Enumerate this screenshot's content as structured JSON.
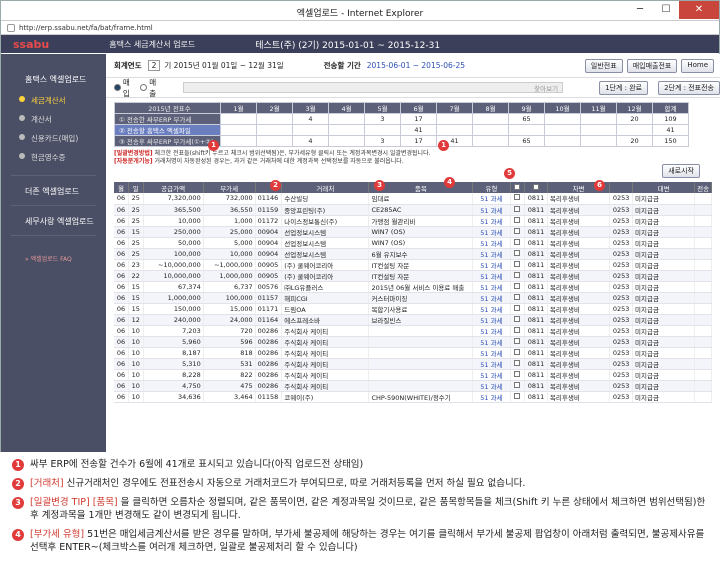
{
  "window": {
    "title": "엑셀업로드 - Internet Explorer",
    "url": "http://erp.ssabu.net/fa/bat/frame.html",
    "min": "─",
    "max": "☐",
    "close": "✕"
  },
  "topnav": {
    "logo": "ssabu",
    "title": "홈택스 세금계산서 업로드",
    "company": "테스트(주) (2기) 2015-01-01 ~ 2015-12-31"
  },
  "sidebar": {
    "header": "홈택스 엑셀업로드",
    "items": [
      {
        "label": "세금계산서"
      },
      {
        "label": "계산서"
      },
      {
        "label": "신용카드(매입)"
      },
      {
        "label": "현금영수증"
      }
    ],
    "section2": "더존 엑셀업로드",
    "section3": "세무사랑 엑셀업로드",
    "faq": "» 엑셀업로드 FAQ"
  },
  "toolbar": {
    "year_label": "회계연도",
    "year_sel": "2",
    "year_text": "기 2015년 01월 01일 ~ 12월 31일",
    "period_label": "전송할 기간",
    "period_value": "2015-06-01 ~ 2015-06-25",
    "btn1": "일반전표",
    "btn2": "매입매출전표",
    "btn3": "Home"
  },
  "filter": {
    "r1": "매입",
    "r2": "매출",
    "search": "찾아보기",
    "btn_step1": "1단계 : 완료",
    "btn_step2": "2단계 : 전표전송"
  },
  "summary": {
    "header_label": "2015년 전표수",
    "months": [
      "1월",
      "2월",
      "3월",
      "4월",
      "5월",
      "6월",
      "7월",
      "8월",
      "9월",
      "10월",
      "11월",
      "12월",
      "합계"
    ],
    "rows": [
      {
        "label": "① 전송한 싸부ERP 부가세",
        "vals": [
          "",
          "",
          "4",
          "",
          "3",
          "17",
          "",
          "",
          "65",
          "",
          "",
          "20",
          "109"
        ]
      },
      {
        "label": "② 전송할 홈택스 엑셀파일",
        "vals": [
          "",
          "",
          "",
          "",
          "",
          "41",
          "",
          "",
          "",
          "",
          "",
          "",
          "41"
        ]
      },
      {
        "label": "③ 전송후 싸부ERP 부가세(①+②)",
        "vals": [
          "",
          "",
          "4",
          "",
          "3",
          "17",
          "41",
          "",
          "65",
          "",
          "",
          "20",
          "150"
        ]
      }
    ]
  },
  "notice": {
    "l1a": "[일괄변경방법]",
    "l1b": "체크한 전표들(shift키 누르고 체크시 범위선택됨)은, 부가세유형 클릭시 또는 계정과목변경시 일괄변경됩니다.",
    "l2a": "[자동분개기능]",
    "l2b": "거래처명이 자동완성된 경우는, 과거 같은 거래처에 대한 계정과목 선택정보를 자동으로 불러옵니다.",
    "reset": "새로시작"
  },
  "grid": {
    "headers": [
      "월",
      "일",
      "공급가액",
      "부가세",
      "",
      "거래처",
      "품목",
      "유형",
      "",
      "",
      "차변",
      "",
      "대변",
      "",
      "전송"
    ],
    "rows": [
      [
        "06",
        "25",
        "7,320,000",
        "732,000",
        "01146",
        "수산빌딩",
        "임대료",
        "51 과세",
        "0811",
        "복리후생비",
        "0253",
        "미지급금"
      ],
      [
        "06",
        "25",
        "365,500",
        "36,550",
        "01159",
        "중앙프린팅(주)",
        "CE285AC",
        "51 과세",
        "0811",
        "복리후생비",
        "0253",
        "미지급금"
      ],
      [
        "06",
        "25",
        "10,000",
        "1,000",
        "01172",
        "나이스정보통신(주)",
        "가맹점 월관리비",
        "51 과세",
        "0811",
        "복리후생비",
        "0253",
        "미지급금"
      ],
      [
        "06",
        "15",
        "250,000",
        "25,000",
        "00904",
        "선업정보시스템",
        "WIN7 (OS)",
        "51 과세",
        "0811",
        "복리후생비",
        "0253",
        "미지급금"
      ],
      [
        "06",
        "25",
        "50,000",
        "5,000",
        "00904",
        "선업정보시스템",
        "WIN7 (OS)",
        "51 과세",
        "0811",
        "복리후생비",
        "0253",
        "미지급금"
      ],
      [
        "06",
        "25",
        "100,000",
        "10,000",
        "00904",
        "선업정보시스템",
        "6월 유지보수",
        "51 과세",
        "0811",
        "복리후생비",
        "0253",
        "미지급금"
      ],
      [
        "06",
        "23",
        "~10,000,000",
        "~1,000,000",
        "00905",
        "(주) 쿨웨어코리아",
        "IT컨설팅 자문",
        "51 과세",
        "0811",
        "복리후생비",
        "0253",
        "미지급금"
      ],
      [
        "06",
        "22",
        "10,000,000",
        "1,000,000",
        "00905",
        "(주) 쿨웨어코리아",
        "IT컨설팅 자문",
        "51 과세",
        "0811",
        "복리후생비",
        "0253",
        "미지급금"
      ],
      [
        "06",
        "15",
        "67,374",
        "6,737",
        "00576",
        "㈜LG유플러스",
        "2015년 06월 서비스 이용료 매출",
        "51 과세",
        "0811",
        "복리후생비",
        "0253",
        "미지급금"
      ],
      [
        "06",
        "15",
        "1,000,000",
        "100,000",
        "01157",
        "해피CGI",
        "커스터마이징",
        "51 과세",
        "0811",
        "복리후생비",
        "0253",
        "미지급금"
      ],
      [
        "06",
        "15",
        "150,000",
        "15,000",
        "01171",
        "드림OA",
        "복합기사용료",
        "51 과세",
        "0811",
        "복리후생비",
        "0253",
        "미지급금"
      ],
      [
        "06",
        "12",
        "240,000",
        "24,000",
        "01164",
        "에스프레소바",
        "브라질빈스",
        "51 과세",
        "0811",
        "복리후생비",
        "0253",
        "미지급금"
      ],
      [
        "06",
        "10",
        "7,203",
        "720",
        "00286",
        "주식회사 케이티",
        "",
        "51 과세",
        "0811",
        "복리후생비",
        "0253",
        "미지급금"
      ],
      [
        "06",
        "10",
        "5,960",
        "596",
        "00286",
        "주식회사 케이티",
        "",
        "51 과세",
        "0811",
        "복리후생비",
        "0253",
        "미지급금"
      ],
      [
        "06",
        "10",
        "8,187",
        "818",
        "00286",
        "주식회사 케이티",
        "",
        "51 과세",
        "0811",
        "복리후생비",
        "0253",
        "미지급금"
      ],
      [
        "06",
        "10",
        "5,310",
        "531",
        "00286",
        "주식회사 케이티",
        "",
        "51 과세",
        "0811",
        "복리후생비",
        "0253",
        "미지급금"
      ],
      [
        "06",
        "10",
        "8,228",
        "822",
        "00286",
        "주식회사 케이티",
        "",
        "51 과세",
        "0811",
        "복리후생비",
        "0253",
        "미지급금"
      ],
      [
        "06",
        "10",
        "4,750",
        "475",
        "00286",
        "주식회사 케이티",
        "",
        "51 과세",
        "0811",
        "복리후생비",
        "0253",
        "미지급금"
      ],
      [
        "06",
        "10",
        "34,636",
        "3,464",
        "01158",
        "코웨이(주)",
        "CHP-590N(WHITE)/정수기",
        "51 과세",
        "0811",
        "복리후생비",
        "0253",
        "미지급금"
      ]
    ]
  },
  "notes": [
    {
      "n": "1",
      "text": "싸부 ERP에 전송할 건수가 6월에 41개로 표시되고 있습니다(아직 업로드전 상태임)"
    },
    {
      "n": "2",
      "head": "[거래처]",
      "text": " 신규거래처인 경우에도 전표전송시 자동으로 거래처코드가 부여되므로, 따로 거래처등록을 먼저 하실 필요 없습니다."
    },
    {
      "n": "3",
      "head": "[일괄변경 TIP] [품목]",
      "text": " 을 클릭하면 오름차순 정렬되며, 같은 품목이면, 같은 계정과목일 것이므로, 같은 품목항목들을 체크(Shift 키 누른 상태에서 체크하면 범위선택됨)한 후 계정과목을 1개만 변경해도 같이 변경되게 됩니다."
    },
    {
      "n": "4",
      "head": "[부가세 유형]",
      "text": " 51번은 매입세금계산서를 받은 경우를 말하며, 부가세 불공제에 해당하는 경우는 여기를 클릭해서 부가세 불공제 팝업창이 아래처럼 출력되면, 불공제사유를 선택후 ENTER~(체크박스를 여러개 체크하면, 일괄로 불공제처리 할 수 있습니다)"
    }
  ],
  "callouts": {
    "c1": "1",
    "c1b": "1",
    "c2": "2",
    "c3": "3",
    "c4": "4",
    "c5": "5",
    "c6": "6"
  }
}
